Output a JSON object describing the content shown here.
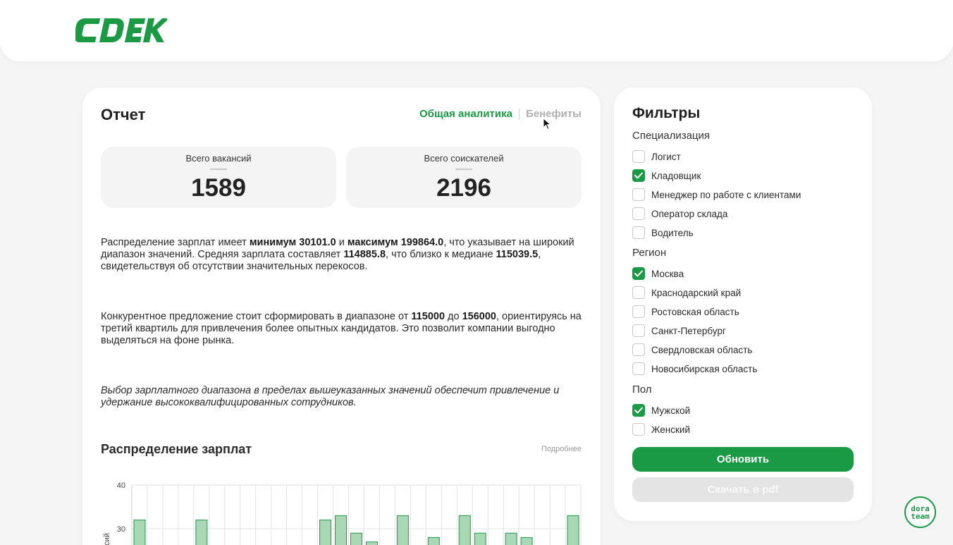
{
  "brand": {
    "logo_text": "CDEK",
    "accent": "#1a9a45"
  },
  "report": {
    "title": "Отчет",
    "tabs": [
      {
        "label": "Общая аналитика",
        "active": true
      },
      {
        "label": "Бенефиты",
        "active": false
      }
    ],
    "stats": [
      {
        "label": "Всего вакансий",
        "value": "1589"
      },
      {
        "label": "Всего соискателей",
        "value": "2196"
      }
    ],
    "paragraph1": {
      "t1": "Распределение зарплат имеет ",
      "b1": "минимум 30101.0",
      "t2": " и ",
      "b2": "максимум 199864.0",
      "t3": ", что указывает на широкий диапазон значений. Средняя зарплата составляет ",
      "b3": "114885.8",
      "t4": ", что близко к медиане ",
      "b4": "115039.5",
      "t5": ", свидетельствуя об отсутствии значительных перекосов."
    },
    "paragraph2": {
      "t1": "Конкурентное предложение стоит сформировать в диапазоне от ",
      "b1": "115000",
      "t2": " до ",
      "b2": "156000",
      "t3": ", ориентируясь на третий квартиль для привлечения более опытных кандидатов. Это позволит компании выгодно выделяться на фоне рынка."
    },
    "paragraph3": "Выбор зарплатного диапазона в пределах вышеуказанных значений обеспечит привлечение и удержание высококвалифицированных сотрудников.",
    "distribution": {
      "title": "Распределение зарплат",
      "more_label": "Подробнее"
    }
  },
  "chart_data": {
    "type": "bar",
    "ylabel": "...сий",
    "yticks": [
      30,
      40
    ],
    "ylim": [
      20,
      40
    ],
    "bin_count": 29,
    "values": [
      32,
      0,
      0,
      0,
      32,
      0,
      0,
      0,
      0,
      0,
      0,
      0,
      32,
      33,
      29,
      27,
      0,
      33,
      0,
      28,
      0,
      33,
      29,
      0,
      29,
      28,
      0,
      0,
      33
    ],
    "bar_color": "#a8d9b4",
    "bar_stroke": "#1a9a45"
  },
  "filters": {
    "title": "Фильтры",
    "groups": [
      {
        "label": "Специализация",
        "options": [
          {
            "label": "Логист",
            "checked": false
          },
          {
            "label": "Кладовщик",
            "checked": true
          },
          {
            "label": "Менеджер по работе с клиентами",
            "checked": false
          },
          {
            "label": "Оператор склада",
            "checked": false
          },
          {
            "label": "Водитель",
            "checked": false
          }
        ]
      },
      {
        "label": "Регион",
        "options": [
          {
            "label": "Москва",
            "checked": true
          },
          {
            "label": "Краснодарский край",
            "checked": false
          },
          {
            "label": "Ростовская область",
            "checked": false
          },
          {
            "label": "Санкт-Петербург",
            "checked": false
          },
          {
            "label": "Свердловская область",
            "checked": false
          },
          {
            "label": "Новосибирская область",
            "checked": false
          }
        ]
      },
      {
        "label": "Пол",
        "options": [
          {
            "label": "Мужской",
            "checked": true
          },
          {
            "label": "Женский",
            "checked": false
          }
        ]
      }
    ],
    "update_label": "Обновить",
    "pdf_label": "Скачать в pdf"
  },
  "badge": {
    "line1": "dora",
    "line2": "team"
  }
}
